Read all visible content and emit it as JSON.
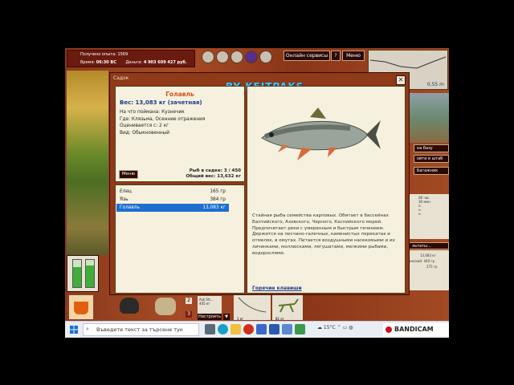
{
  "topbar": {
    "experience_label": "Получено опыта: 1569",
    "time_label": "Время:",
    "time_value": "06:30 ВС",
    "money_label": "Деньги:",
    "money_value": "4 903 609 427 руб.",
    "online_services": "Онлайн сервисы",
    "help": "?",
    "menu": "Меню"
  },
  "map": {
    "depth": "0,55 m"
  },
  "dialog": {
    "title": "Садок",
    "watermark": "BY KEITPAKS",
    "close": "✕",
    "fish": {
      "name": "Голавль",
      "weight": "Вес: 13,083 кг (зачетная)",
      "lines": [
        "На что поймана: Кузнечик",
        "Где: Клязьма, Осенние отражения",
        "Оценивается с: 2 кг",
        "Вид: Обыкновенный"
      ]
    },
    "menu_button": "Меню",
    "keep_count": "Рыб в садке: 3 / 450",
    "keep_total": "Общий вес: 13,632 кг",
    "catch_list": [
      {
        "name": "Елец",
        "weight": "165 гр"
      },
      {
        "name": "Язь",
        "weight": "384 гр"
      },
      {
        "name": "Голавль",
        "weight": "13,083 кг"
      }
    ],
    "description": "Стайная рыба семейства карповых. Обитает в бассейнах Балтийского, Азовского, Черного, Каспийского морей. Предпочитает реки с умеренным и быстрым течением. Держится на песчано-галечных, каменистых перекатах и отмелях, в омутах. Питается воздушными насекомыми и их личинками, моллюсками, лягушатами, мелкими рыбами, водорослями.",
    "hotkeys": "Горячие клавиши"
  },
  "right_panel": {
    "to_base": "на базу",
    "to_hq": "ойти в штаб",
    "trunk": "Багажник",
    "results": "льтаты...",
    "info_lines": [
      "06 час.",
      "30 мин.",
      "л.",
      "н.",
      "н."
    ],
    "bottom_lines": [
      "13,083 кг",
      "ьнинский: 440 гр",
      "275 гр"
    ]
  },
  "bottombar": {
    "count1": "2",
    "count2": "3",
    "tackle_text": "Ask Str... 445 кг",
    "setup": "Настроить",
    "setup_arrow": "▼",
    "rod_label": "1 кг",
    "lure_label": "81 кг"
  },
  "gauges": {
    "fill_1": 0.75,
    "fill_2": 0.78
  },
  "taskbar": {
    "search_placeholder": "Въведете текст за търсене тук",
    "weather": "15°C",
    "bandicam": "BANDICAM"
  },
  "colors": {
    "selection": "#1c6fcf",
    "fish_name": "#d0501a",
    "weight_text": "#1b3a8a",
    "watermark": "#3fc8ff"
  }
}
